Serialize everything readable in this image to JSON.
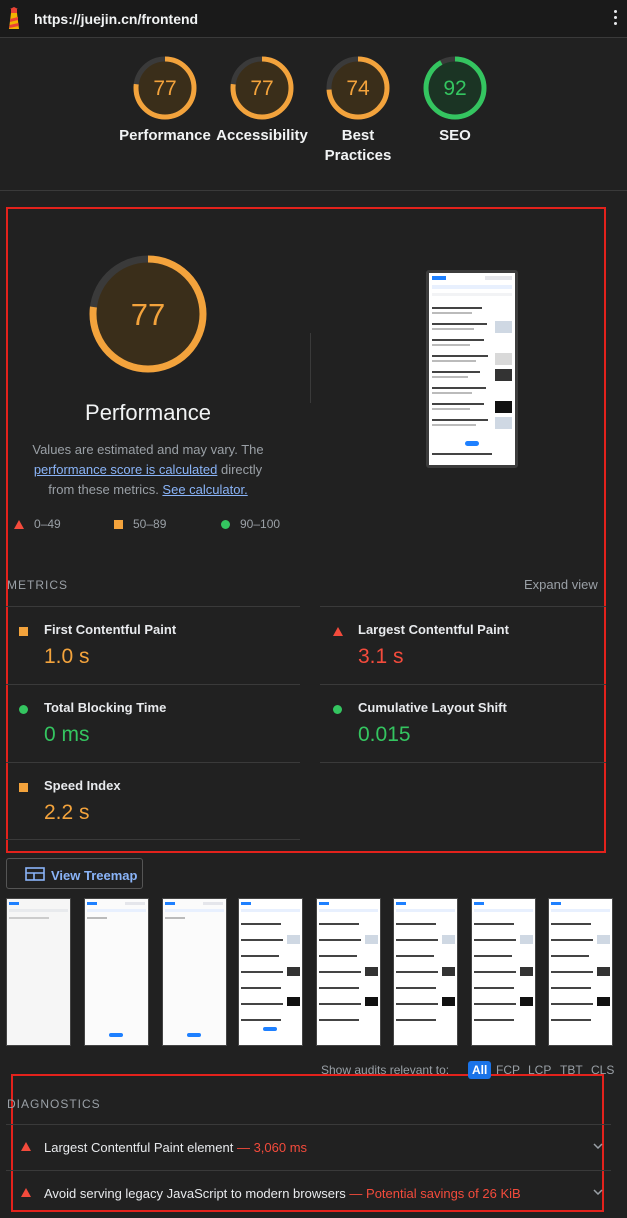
{
  "url": "https://juejin.cn/frontend",
  "categories": [
    {
      "score": "77",
      "label": "Performance",
      "status": "average"
    },
    {
      "score": "77",
      "label": "Accessibility",
      "status": "average"
    },
    {
      "score": "74",
      "label": "Best Practices",
      "status": "average"
    },
    {
      "score": "92",
      "label": "SEO",
      "status": "pass"
    }
  ],
  "performance": {
    "score": "77",
    "title": "Performance",
    "desc_a": "Values are estimated and may vary. The",
    "desc_link1": "performance score is calculated",
    "desc_b": " directly from these metrics. ",
    "desc_link2": "See calculator."
  },
  "legend": {
    "fail": "0–49",
    "average": "50–89",
    "pass": "90–100"
  },
  "metrics": {
    "heading": "METRICS",
    "expand_label": "Expand view",
    "items": [
      {
        "label": "First Contentful Paint",
        "value": "1.0 s",
        "status": "average"
      },
      {
        "label": "Largest Contentful Paint",
        "value": "3.1 s",
        "status": "fail"
      },
      {
        "label": "Total Blocking Time",
        "value": "0 ms",
        "status": "pass"
      },
      {
        "label": "Cumulative Layout Shift",
        "value": "0.015",
        "status": "pass"
      },
      {
        "label": "Speed Index",
        "value": "2.2 s",
        "status": "average"
      }
    ]
  },
  "treemap_label": "View Treemap",
  "audit_filter": {
    "label": "Show audits relevant to:",
    "options": [
      "All",
      "FCP",
      "LCP",
      "TBT",
      "CLS"
    ],
    "selected": "All"
  },
  "diagnostics": {
    "heading": "DIAGNOSTICS",
    "items": [
      {
        "title": "Largest Contentful Paint element",
        "detail": "3,060 ms"
      },
      {
        "title": "Avoid serving legacy JavaScript to modern browsers",
        "detail": "Potential savings of 26 KiB"
      }
    ]
  },
  "colors": {
    "average": "#f3a33c",
    "fail": "#f44b3c",
    "pass": "#34c560",
    "link": "#8ab4f8",
    "highlight": "#e3221c"
  }
}
